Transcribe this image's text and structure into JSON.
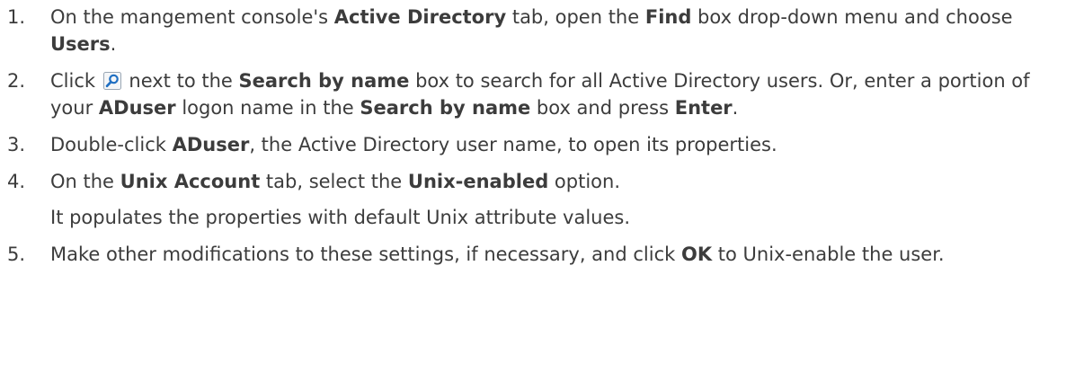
{
  "steps": [
    {
      "number": "1.",
      "t1": "On the mangement console's ",
      "b1": "Active Directory",
      "t2": " tab, open the ",
      "b2": "Find",
      "t3": " box drop-down menu and choose ",
      "b3": "Users",
      "t4": "."
    },
    {
      "number": "2.",
      "t1": "Click ",
      "icon": "search-icon",
      "t2": " next to the ",
      "b1": "Search by name",
      "t3": " box to search for all Active Directory users. Or, enter a portion of your ",
      "b2": "ADuser",
      "t4": " logon name in the ",
      "b3": "Search by name",
      "t5": " box and press ",
      "b4": "Enter",
      "t6": "."
    },
    {
      "number": "3.",
      "t1": "Double-click ",
      "b1": "ADuser",
      "t2": ", the Active Directory user name, to open its properties."
    },
    {
      "number": "4.",
      "t1": "On the ",
      "b1": "Unix Account",
      "t2": " tab, select the ",
      "b2": "Unix-enabled",
      "t3": " option.",
      "note": "It populates the properties with default Unix attribute values."
    },
    {
      "number": "5.",
      "t1": "Make other modifications to these settings, if necessary, and click ",
      "b1": "OK",
      "t2": " to Unix-enable the user."
    }
  ],
  "colors": {
    "text": "#3c3c3c",
    "icon_blue": "#1f6fc2",
    "icon_border": "#9aa7b4"
  }
}
